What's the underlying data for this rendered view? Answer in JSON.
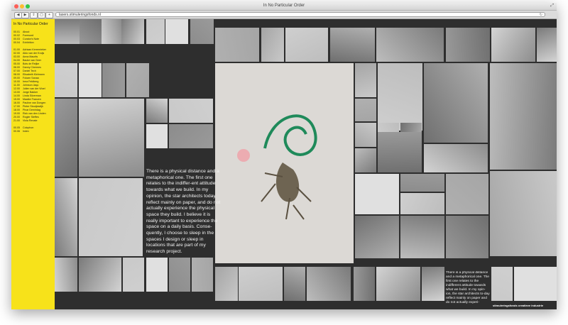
{
  "window": {
    "title": "In No Particular Order"
  },
  "toolbar": {
    "url": "lasers.stimuleringsfonds.nl"
  },
  "sidebar": {
    "title": "In No Particular Order",
    "intro": [
      {
        "num": "00.01",
        "label": "About"
      },
      {
        "num": "00.02",
        "label": "Foreword"
      },
      {
        "num": "00.03",
        "label": "Curator's Note"
      },
      {
        "num": "00.04",
        "label": "Exhibition"
      }
    ],
    "people": [
      {
        "num": "01.00",
        "label": "Adriaan Kerremieker"
      },
      {
        "num": "02.00",
        "label": "Aldo van der Kruijs"
      },
      {
        "num": "03.00",
        "label": "Anna Maurits"
      },
      {
        "num": "04.00",
        "label": "Bauke van Geer"
      },
      {
        "num": "05.00",
        "label": "Bots de Reijke"
      },
      {
        "num": "06.00",
        "label": "Danny Chermes"
      },
      {
        "num": "07.00",
        "label": "Daniel Tech"
      },
      {
        "num": "08.00",
        "label": "Elisabeth Kleimann"
      },
      {
        "num": "09.00",
        "label": "Fokarn Sanaa"
      },
      {
        "num": "10.00",
        "label": "Irma Feldberg"
      },
      {
        "num": "11.00",
        "label": "Johnson Jaqu"
      },
      {
        "num": "12.00",
        "label": "Julien van der Woel"
      },
      {
        "num": "13.00",
        "label": "Jorge Bakker"
      },
      {
        "num": "14.00",
        "label": "Linda Silverman"
      },
      {
        "num": "15.00",
        "label": "Maaike Franzen"
      },
      {
        "num": "16.00",
        "label": "Pauline van Dongen"
      },
      {
        "num": "17.00",
        "label": "Pieter Stoutjesdijk"
      },
      {
        "num": "18.00",
        "label": "Pinar Demirdag"
      },
      {
        "num": "19.00",
        "label": "Rick van den Linden"
      },
      {
        "num": "20.00",
        "label": "Rogier Steffes"
      },
      {
        "num": "21.00",
        "label": "Viola Renate"
      }
    ],
    "outro": [
      {
        "num": "00.05",
        "label": "Colophon"
      },
      {
        "num": "00.06",
        "label": "Index"
      }
    ]
  },
  "main": {
    "quote": "There is a physical distance and a metaphorical one. The first one relates to the indiffer-ent attitude towards what we build. In my opinion, the star architects today reflect mainly on paper, and do not actually experience the physical space they build. I believe it is really important to experience the space on a daily basis. Conse-quently, I choose to sleep in the spaces I design or sleep in locations that are part of my research project.",
    "quote2": "There is a physical distance and a metaphorical one. The first one relates to the indifferent attitude towards what we build. In my opin-ion, the star architects to-day reflect mainly on paper and do not actually experi-",
    "credit": "stimuleringsfonds creatieve industrie"
  }
}
